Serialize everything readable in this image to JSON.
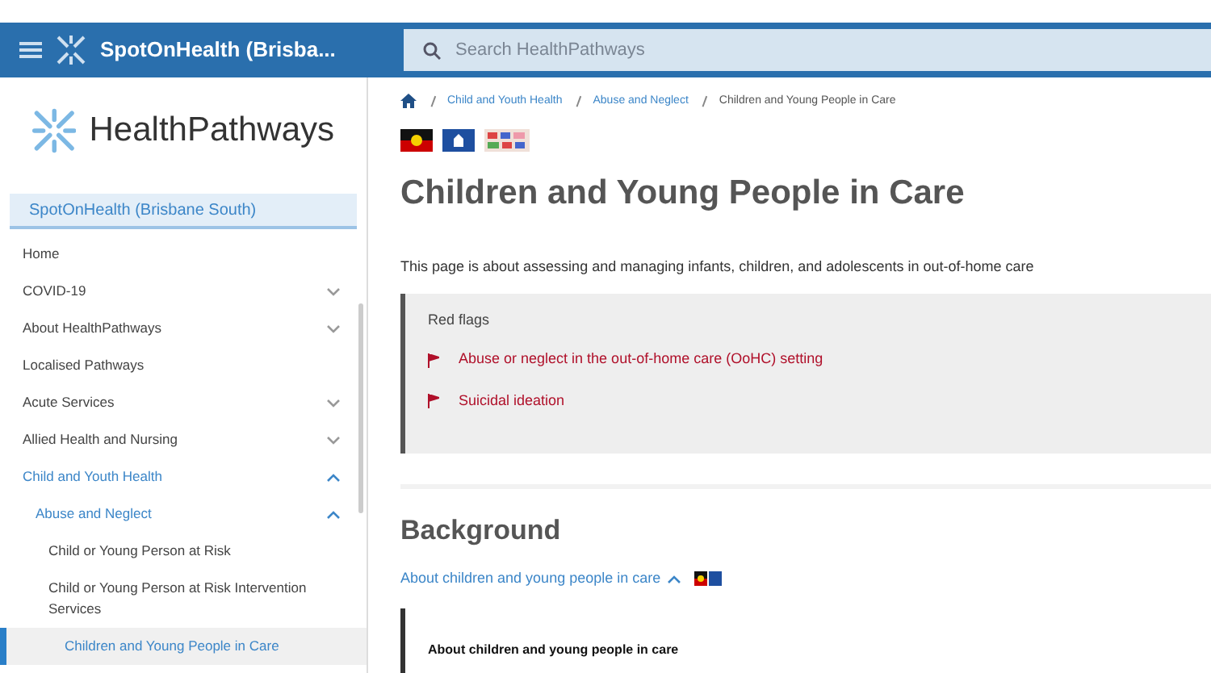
{
  "header": {
    "site": "SpotOnHealth (Brisba...",
    "search": {
      "placeholder": "Search HealthPathways"
    }
  },
  "sidebar": {
    "logo": "HealthPathways",
    "region": "SpotOnHealth (Brisbane South)",
    "items": [
      {
        "label": "Home",
        "selected": false
      },
      {
        "label": "COVID-19",
        "selected": false,
        "expanded": false
      },
      {
        "label": "About HealthPathways",
        "selected": false,
        "expanded": false
      },
      {
        "label": "Localised Pathways",
        "selected": false
      },
      {
        "label": "Acute Services",
        "selected": false,
        "expanded": false
      },
      {
        "label": "Allied Health and Nursing",
        "selected": false,
        "expanded": false
      },
      {
        "label": "Child and Youth Health",
        "selected": false,
        "expanded": true,
        "children": [
          {
            "label": "Abuse and Neglect",
            "selected": false,
            "expanded": true,
            "children": [
              {
                "label": "Child or Young Person at Risk",
                "selected": false
              },
              {
                "label": "Child or Young Person at Risk Intervention Services",
                "selected": false
              },
              {
                "label": "Children and Young People in Care",
                "selected": true
              }
            ]
          }
        ]
      }
    ]
  },
  "breadcrumb": [
    "Child and Youth Health",
    "Abuse and Neglect",
    "Children and Young People in Care"
  ],
  "title": "Children and Young People in Care",
  "intro": "This page is about assessing and managing infants, children, and adolescents in out-of-home care",
  "red_flags": {
    "heading": "Red flags",
    "items": [
      "Abuse or neglect in the out-of-home care (OoHC) setting",
      "Suicidal ideation"
    ]
  },
  "background": {
    "heading": "Background",
    "link": "About children and young people in care",
    "expanded": true,
    "box_title": "About children and young people in care"
  }
}
